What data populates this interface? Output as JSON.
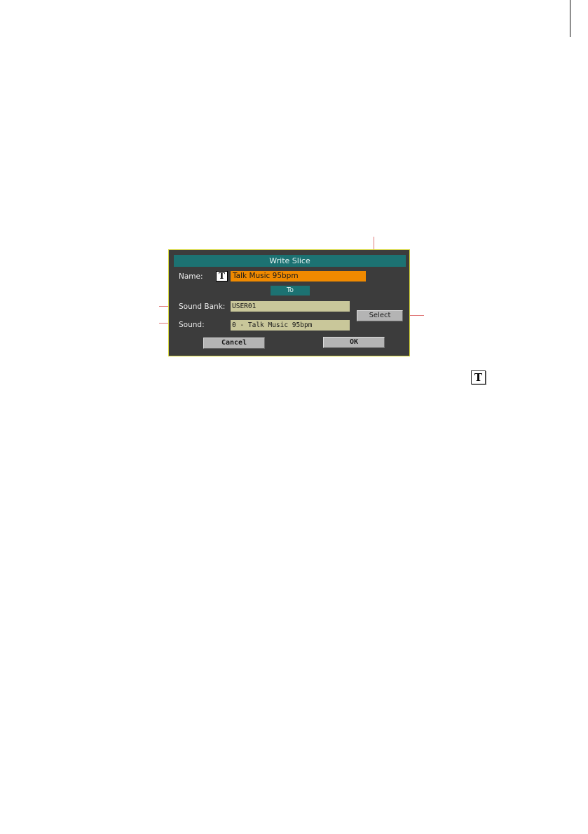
{
  "dialog": {
    "title": "Write Slice",
    "name_label": "Name:",
    "name_value": "Talk Music 95bpm",
    "text_edit_icon": "T",
    "to_label": "To",
    "sound_bank_label": "Sound Bank:",
    "sound_bank_value": "USER01",
    "sound_label": "Sound:",
    "sound_value": "0 - Talk Music 95bpm",
    "select_label": "Select",
    "cancel_label": "Cancel",
    "ok_label": "OK"
  },
  "side_icon": "T",
  "colors": {
    "accent_teal": "#1c7272",
    "name_field_orange": "#f08a00",
    "field_khaki": "#c9c79a",
    "dialog_border": "#d6d63a",
    "callout_line": "#e07878"
  }
}
